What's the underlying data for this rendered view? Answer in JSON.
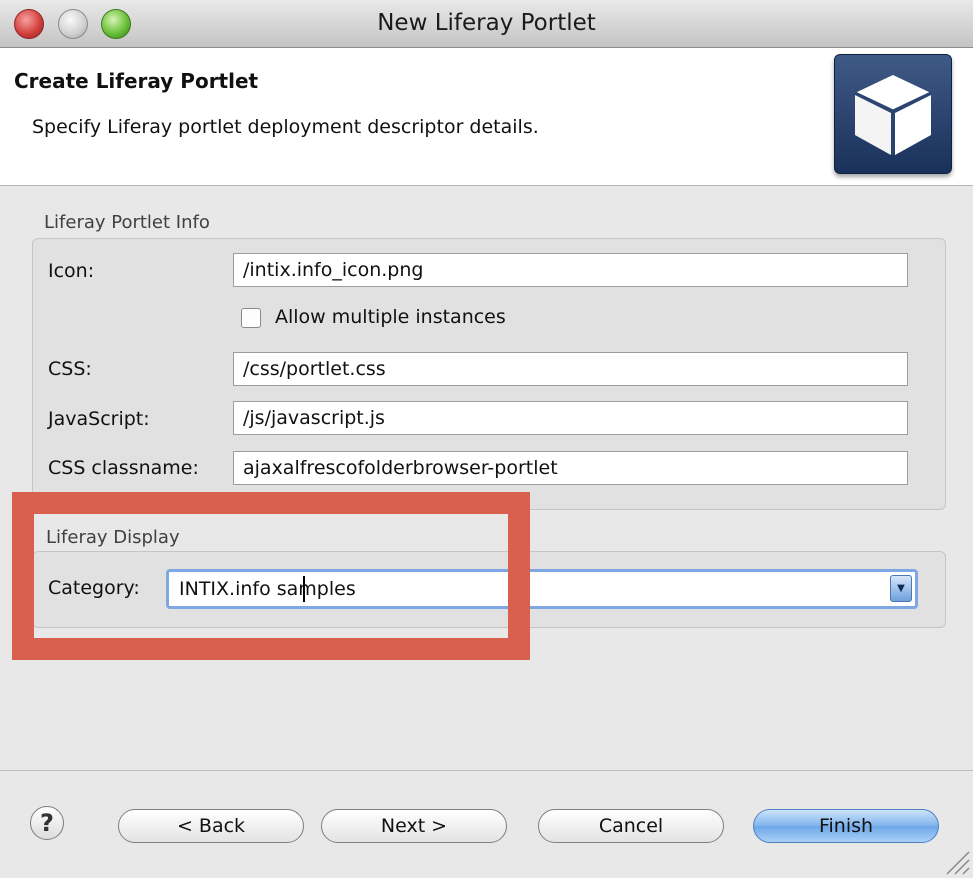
{
  "window": {
    "title": "New Liferay Portlet"
  },
  "header": {
    "title": "Create Liferay Portlet",
    "description": "Specify Liferay portlet deployment descriptor details."
  },
  "portlet_info": {
    "group_label": "Liferay Portlet Info",
    "icon_label": "Icon:",
    "icon_value": "/intix.info_icon.png",
    "allow_multiple_label": "Allow multiple instances",
    "allow_multiple_checked": false,
    "css_label": "CSS:",
    "css_value": "/css/portlet.css",
    "javascript_label": "JavaScript:",
    "javascript_value": "/js/javascript.js",
    "css_classname_label": "CSS classname:",
    "css_classname_value": "ajaxalfrescofolderbrowser-portlet"
  },
  "display": {
    "group_label": "Liferay Display",
    "category_label": "Category:",
    "category_value": "INTIX.info samples"
  },
  "buttons": {
    "help": "?",
    "back": "< Back",
    "next": "Next >",
    "cancel": "Cancel",
    "finish": "Finish"
  },
  "colors": {
    "highlight_box": "#d9604d",
    "focus_ring": "#7ea7e3",
    "primary_button": "#7fb3ec"
  }
}
